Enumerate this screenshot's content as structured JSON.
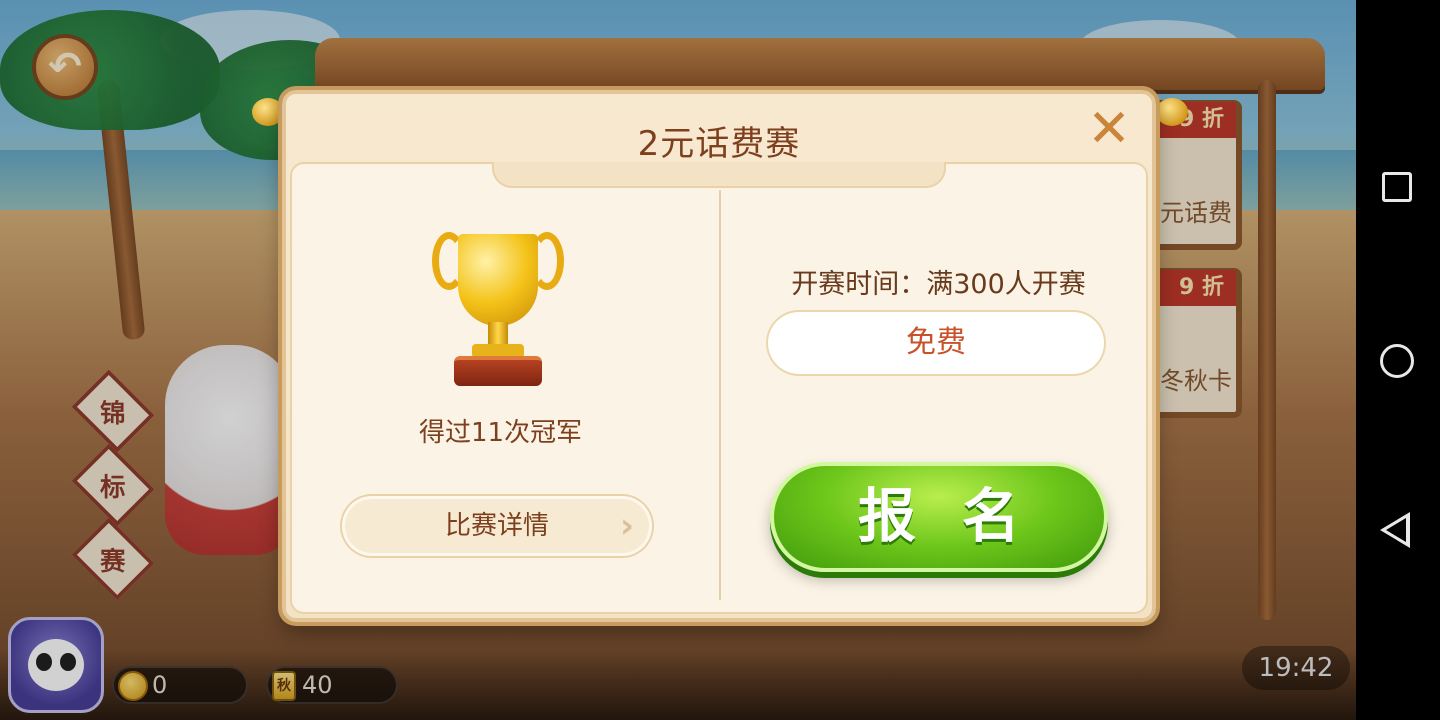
{
  "background": {
    "side_boards": [
      {
        "tag": "9 折",
        "text": "元话费"
      },
      {
        "tag": "9 折",
        "text": "冬秋卡"
      }
    ],
    "signpost": [
      "锦",
      "标",
      "赛"
    ]
  },
  "dialog": {
    "title": "2元话费赛",
    "close_label": "✕",
    "champion_text": "得过11次冠军",
    "detail_button": "比赛详情",
    "detail_chevron": "›",
    "start_time": "开赛时间：满300人开赛",
    "fee": "免费",
    "signup_button": "报名"
  },
  "status": {
    "coins": "0",
    "cards": "40",
    "card_icon_letter": "秋",
    "clock": "19:42"
  },
  "colors": {
    "accent_green": "#6dc61a",
    "title_brown": "#7d3f1d",
    "fee_red": "#c8532a"
  },
  "icons": {
    "back": "back-arrow-icon",
    "close": "close-icon",
    "trophy": "trophy-icon",
    "coin": "coin-icon",
    "card": "card-icon",
    "share": "share-icon"
  }
}
